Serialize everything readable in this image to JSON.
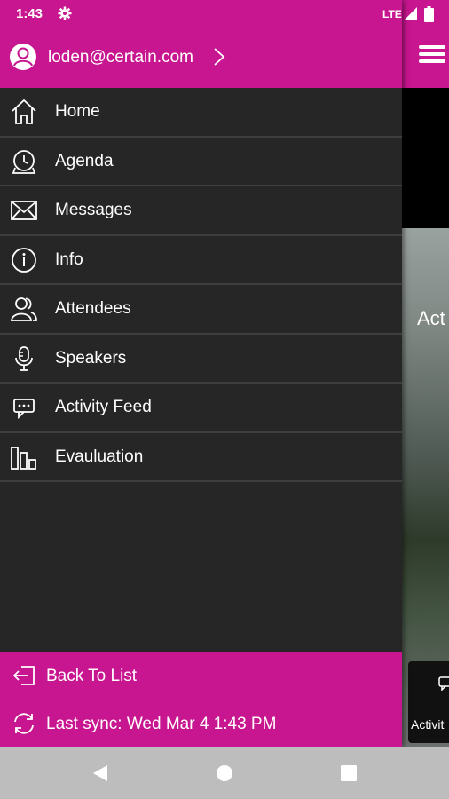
{
  "status": {
    "time": "1:43",
    "network": "LTE",
    "icons": [
      "gear-icon",
      "signal-icon",
      "battery-icon"
    ]
  },
  "account": {
    "email": "loden@certain.com"
  },
  "menu": {
    "items": [
      {
        "label": "Home",
        "icon": "home-icon"
      },
      {
        "label": "Agenda",
        "icon": "clock-icon"
      },
      {
        "label": "Messages",
        "icon": "mail-icon"
      },
      {
        "label": "Info",
        "icon": "info-icon"
      },
      {
        "label": "Attendees",
        "icon": "people-icon"
      },
      {
        "label": "Speakers",
        "icon": "microphone-icon"
      },
      {
        "label": "Activity Feed",
        "icon": "chat-icon"
      },
      {
        "label": "Evauluation",
        "icon": "bar-chart-icon"
      }
    ]
  },
  "footer": {
    "back_label": "Back To List",
    "sync_label": "Last sync: Wed Mar 4 1:43 PM"
  },
  "background": {
    "photo_title": "Act",
    "tile_label": "Activit"
  },
  "colors": {
    "accent": "#c7168f",
    "drawer_bg": "#262626",
    "divider": "#3e3e3e",
    "nav_bar": "#bdbdbd"
  }
}
